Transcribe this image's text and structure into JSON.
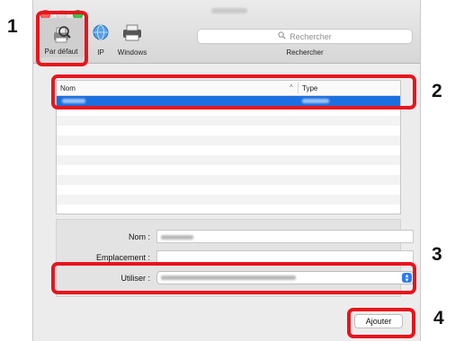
{
  "toolbar": {
    "default_label": "Par défaut",
    "ip_label": "IP",
    "windows_label": "Windows",
    "search_placeholder": "Rechercher",
    "search_label": "Rechercher"
  },
  "printer_list": {
    "col_name": "Nom",
    "col_type": "Type",
    "sort_indicator": "^"
  },
  "form": {
    "name_label": "Nom :",
    "location_label": "Emplacement :",
    "use_label": "Utiliser :"
  },
  "actions": {
    "add_label": "Ajouter"
  },
  "callouts": [
    "1",
    "2",
    "3",
    "4"
  ],
  "colors": {
    "callout_red": "#e8141d",
    "selection_blue": "#1b6fe0",
    "stepper_blue": "#2b7cf6"
  },
  "icons": [
    "printer-default-icon",
    "ip-globe-icon",
    "windows-printer-icon",
    "search-icon",
    "stepper-icon"
  ]
}
